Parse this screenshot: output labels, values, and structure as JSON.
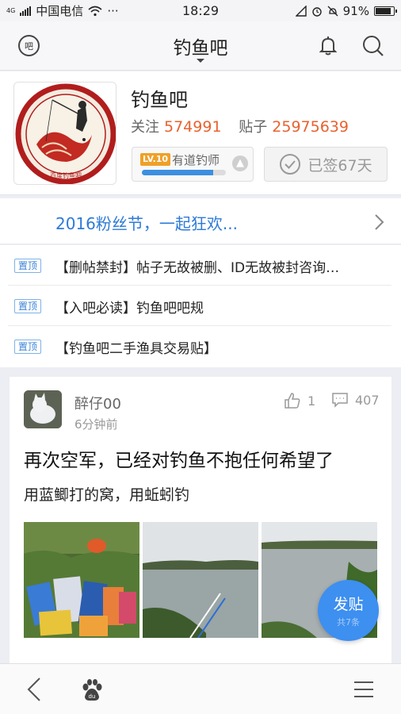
{
  "status_bar": {
    "network_small": "4G",
    "carrier": "中国电信",
    "more": "···",
    "time": "18:29",
    "battery": "91%"
  },
  "header": {
    "title": "钓鱼吧",
    "ba_label": "吧"
  },
  "forum": {
    "name": "钓鱼吧",
    "follow_label": "关注",
    "follow_count": "574991",
    "posts_label": "贴子",
    "posts_count": "25975639",
    "level_badge": "LV.10",
    "level_name": "有道钓师",
    "level_progress": 0.85,
    "signed_text": "已签67天",
    "logo_caption": "百度钓鱼吧"
  },
  "banner": {
    "text": "2016粉丝节，一起狂欢..."
  },
  "pinned": [
    {
      "tag": "置顶",
      "title": "【删帖禁封】帖子无故被删、ID无故被封咨询…"
    },
    {
      "tag": "置顶",
      "title": "【入吧必读】钓鱼吧吧规"
    },
    {
      "tag": "置顶",
      "title": "【钓鱼吧二手渔具交易贴】"
    }
  ],
  "post": {
    "author": "醉仔00",
    "time": "6分钟前",
    "likes": "1",
    "replies": "407",
    "title": "再次空军，已经对钓鱼不抱任何希望了",
    "body": "用蓝鲫打的窝，用蚯蚓钓"
  },
  "fab": {
    "label": "发贴",
    "count": "共7条"
  },
  "colors": {
    "accent_blue": "#3d8ff0",
    "count_orange": "#e8622f",
    "level_orange": "#f0a028"
  }
}
